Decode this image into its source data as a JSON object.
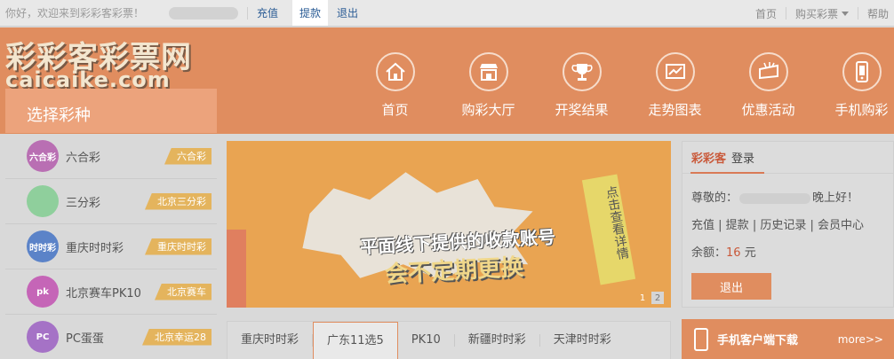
{
  "topbar": {
    "greeting": "你好，欢迎来到彩彩客彩票！",
    "links": [
      "充值",
      "提款",
      "退出"
    ],
    "right_links": [
      "首页",
      "购买彩票",
      "帮助"
    ]
  },
  "header": {
    "logo_cn": "彩彩客彩票网",
    "logo_en": "caicaike.com",
    "select_type": "选择彩种",
    "nav": [
      {
        "label": "首页",
        "icon": "home-icon"
      },
      {
        "label": "购彩大厅",
        "icon": "store-icon"
      },
      {
        "label": "开奖结果",
        "icon": "trophy-icon"
      },
      {
        "label": "走势图表",
        "icon": "chart-icon"
      },
      {
        "label": "优惠活动",
        "icon": "promo-icon"
      },
      {
        "label": "手机购彩",
        "icon": "mobile-icon"
      }
    ]
  },
  "lotteries": [
    {
      "name": "六合彩",
      "tag": "六合彩",
      "ball_text": "六合彩",
      "color": "#b96fb3"
    },
    {
      "name": "三分彩",
      "tag": "北京三分彩",
      "ball_text": "",
      "color": "#8fcf9c"
    },
    {
      "name": "重庆时时彩",
      "tag": "重庆时时彩",
      "ball_text": "时时彩",
      "color": "#5b83c8"
    },
    {
      "name": "北京赛车PK10",
      "tag": "北京赛车",
      "ball_text": "pk",
      "color": "#c565b7"
    },
    {
      "name": "PC蛋蛋",
      "tag": "北京幸运28",
      "ball_text": "PC",
      "color": "#a572c6"
    }
  ],
  "banner": {
    "line1": "平面线下提供的收款账号",
    "line2": "会不定期更换",
    "vertical_tag": "点击查看详情",
    "pages": [
      "1",
      "2"
    ]
  },
  "tabs": [
    "重庆时时彩",
    "广东11选5",
    "PK10",
    "新疆时时彩",
    "天津时时彩"
  ],
  "userbox": {
    "brand": "彩彩客",
    "login": "登录",
    "greeting_prefix": "尊敬的：",
    "greeting_suffix": "晚上好！",
    "links": [
      "充值",
      "提款",
      "历史记录",
      "会员中心"
    ],
    "balance_label": "余额：",
    "balance_value": "16",
    "balance_unit": "元",
    "logout": "退出"
  },
  "app_download": {
    "label": "手机客户端下载",
    "more": "more>>"
  },
  "colors": {
    "accent": "#e08d5f",
    "tag": "#e4b45d",
    "link": "#2b5c95"
  }
}
